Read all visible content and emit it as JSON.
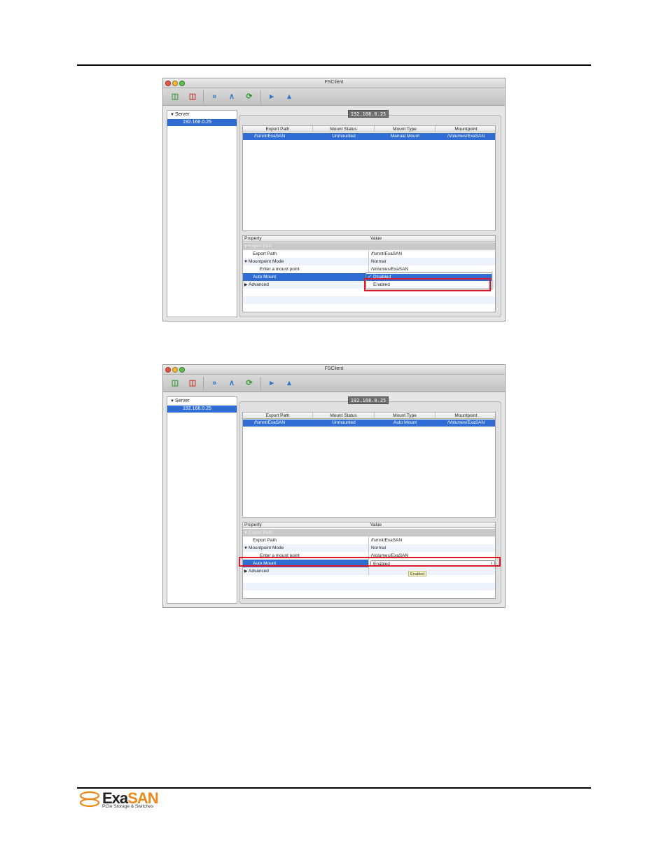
{
  "screenshots": [
    {
      "title": "FSClient",
      "sidebar": {
        "header": "Server",
        "item": "192.168.0.25"
      },
      "server_tab": "192.168.0.25",
      "mounts": {
        "columns": [
          "Export Path",
          "Mount Status",
          "Mount Type",
          "Mountpoint"
        ],
        "row": {
          "export_path": "/fsmnt/ExaSAN",
          "status": "Unmounted",
          "type": "Manual Mount",
          "mountpoint": "/Volumes/ExaSAN"
        }
      },
      "properties": {
        "columns": [
          "Property",
          "Value"
        ],
        "group": "Export Path",
        "rows": [
          {
            "key": "Export Path",
            "value": "/fsmnt/ExaSAN"
          },
          {
            "key": "Mountpoint Mode",
            "value": "Normal"
          },
          {
            "key": "Enter a mount point",
            "value": "/Volumes/ExaSAN"
          },
          {
            "key": "Auto Mount",
            "value": ""
          },
          {
            "key": "Advanced",
            "value": ""
          }
        ]
      },
      "dropdown_options": [
        "Disabled",
        "Enabled"
      ]
    },
    {
      "title": "FSClient",
      "sidebar": {
        "header": "Server",
        "item": "192.168.0.25"
      },
      "server_tab": "192.168.0.25",
      "mounts": {
        "columns": [
          "Export Path",
          "Mount Status",
          "Mount Type",
          "Mountpoint"
        ],
        "row": {
          "export_path": "/fsmnt/ExaSAN",
          "status": "Unmounted",
          "type": "Auto Mount",
          "mountpoint": "/Volumes/ExaSAN"
        }
      },
      "properties": {
        "columns": [
          "Property",
          "Value"
        ],
        "group": "Export Path",
        "rows": [
          {
            "key": "Export Path",
            "value": "/fsmnt/ExaSAN"
          },
          {
            "key": "Mountpoint Mode",
            "value": "Normal"
          },
          {
            "key": "Enter a mount point",
            "value": "/Volumes/ExaSAN"
          },
          {
            "key": "Auto Mount",
            "value": "Enabled"
          },
          {
            "key": "Advanced",
            "value": ""
          }
        ]
      },
      "tooltip": "Enabled"
    }
  ],
  "logo": {
    "word_a": "Exa",
    "word_b": "SAN",
    "tagline": "PCIe Storage & Switches",
    "brand_color": "#e98a1a"
  },
  "colors": {
    "selection": "#2f6dd5",
    "highlight": "#e0162b"
  }
}
